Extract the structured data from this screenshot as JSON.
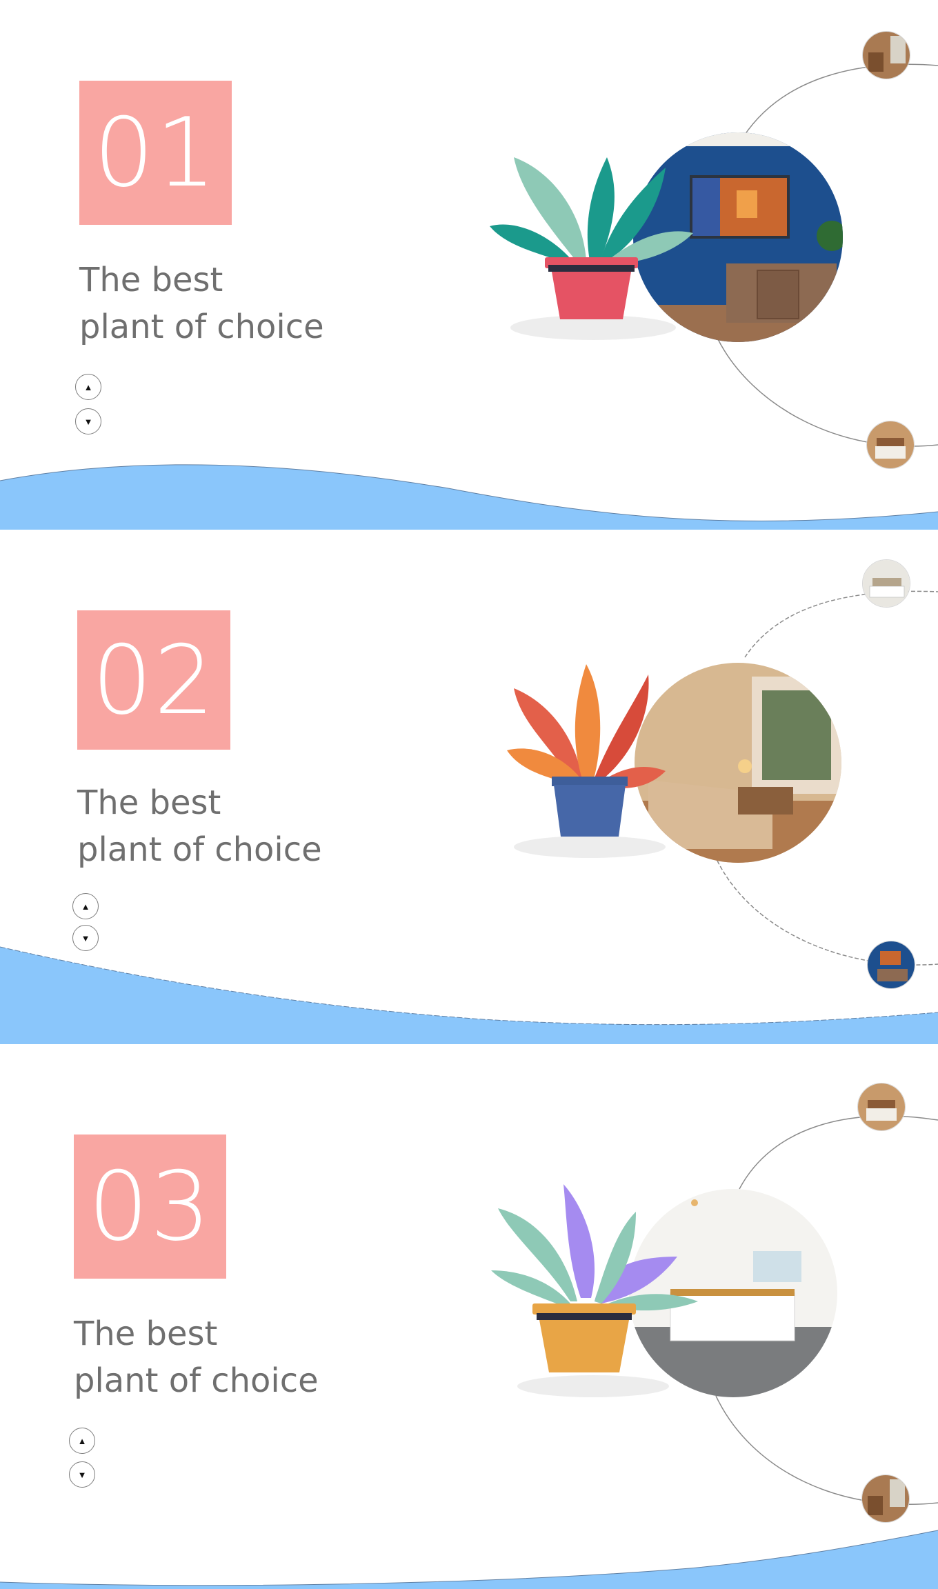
{
  "slides": [
    {
      "number": "01",
      "caption_line1": "The best",
      "caption_line2": "plant of choice",
      "up_arrow": "▲",
      "down_arrow": "▼",
      "plant_icon": "leafy-green-plant-pink-pot-icon",
      "photo_icon": "blue-living-room-photo",
      "thumb_top_icon": "wood-room-thumbnail",
      "thumb_bottom_icon": "bedroom-thumbnail"
    },
    {
      "number": "02",
      "caption_line1": "The best",
      "caption_line2": "plant of choice",
      "up_arrow": "▲",
      "down_arrow": "▼",
      "plant_icon": "orange-leaf-plant-blue-pot-icon",
      "photo_icon": "beige-living-room-photo",
      "thumb_top_icon": "white-bedroom-thumbnail",
      "thumb_bottom_icon": "blue-room-thumbnail"
    },
    {
      "number": "03",
      "caption_line1": "The best",
      "caption_line2": "plant of choice",
      "up_arrow": "▲",
      "down_arrow": "▼",
      "plant_icon": "purple-flower-plant-yellow-pot-icon",
      "photo_icon": "white-kitchen-photo",
      "thumb_top_icon": "bedroom-thumbnail",
      "thumb_bottom_icon": "wood-room-thumbnail"
    }
  ],
  "colors": {
    "number_box": "#f9a6a2",
    "caption_text": "#6f6f6f",
    "wave_blue": "#8ac6fb",
    "orbit_line": "#8a8a8a"
  }
}
